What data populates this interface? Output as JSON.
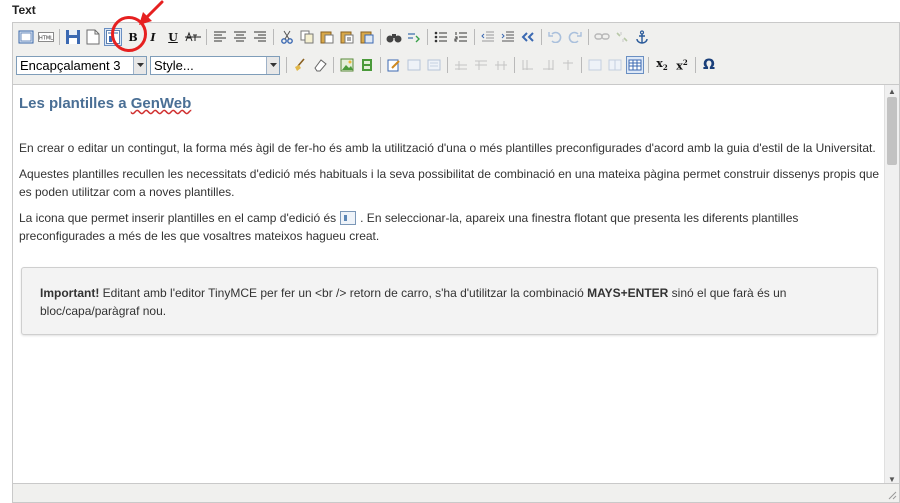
{
  "field": {
    "label": "Text"
  },
  "toolbar": {
    "heading_select": "Encapçalament 3",
    "style_select": "Style...",
    "bold": "B",
    "italic": "I",
    "underline": "U",
    "subscript": "x",
    "superscript": "x",
    "omega": "Ω",
    "html_label": "HTML",
    "active_button": "insert-template-button"
  },
  "content": {
    "title_prefix": "Les plantilles a ",
    "title_link": "GenWeb",
    "p1": "En crear o editar un contingut, la forma més àgil de fer-ho és amb la utilització d'una o més plantilles preconfigurades d'acord amb la guia d'estil de la Universitat.",
    "p2": "Aquestes plantilles recullen les necessitats d'edició més habituals i la seva possibilitat de combinació en una mateixa pàgina permet  construir dissenys propis que es poden utilitzar  com a noves plantilles.",
    "p3_before": "La icona que permet inserir plantilles en el camp d'edició és",
    "p3_after": ". En seleccionar-la, apareix una finestra flotant que presenta les diferents plantilles preconfigurades a més de les que vosaltres mateixos hagueu creat.",
    "note_strong": "Important!",
    "note_text1": " Editant amb l'editor TinyMCE per fer un <br /> retorn de carro, s'ha d'utilitzar la combinació ",
    "note_keys": "MAYS+ENTER",
    "note_text2": " sinó el que farà és un bloc/capa/paràgraf nou."
  },
  "colors": {
    "heading": "#4a6f95",
    "highlight": "#e62020",
    "toolbar_bg": "#f0f0ee"
  }
}
